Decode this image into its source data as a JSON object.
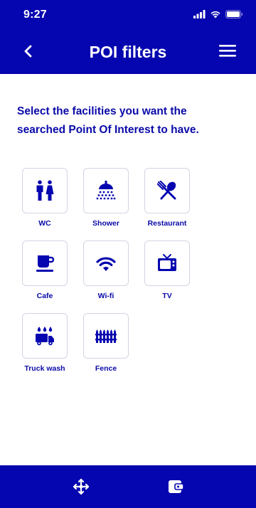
{
  "status_bar": {
    "time": "9:27"
  },
  "header": {
    "title": "POI filters"
  },
  "instructions": "Select the facilities you want the searched Point Of Interest to have.",
  "facilities": [
    {
      "label": "WC",
      "icon": "wc-icon"
    },
    {
      "label": "Shower",
      "icon": "shower-icon"
    },
    {
      "label": "Restaurant",
      "icon": "restaurant-icon"
    },
    {
      "label": "Cafe",
      "icon": "cafe-icon"
    },
    {
      "label": "Wi-fi",
      "icon": "wifi-icon"
    },
    {
      "label": "TV",
      "icon": "tv-icon"
    },
    {
      "label": "Truck wash",
      "icon": "truck-wash-icon"
    },
    {
      "label": "Fence",
      "icon": "fence-icon"
    }
  ],
  "bottom_nav": [
    {
      "icon": "move-icon"
    },
    {
      "icon": "wallet-icon"
    }
  ],
  "colors": {
    "primary": "#0606b0",
    "text": "#0a0aa8",
    "tile_border": "#d4d4e4"
  }
}
